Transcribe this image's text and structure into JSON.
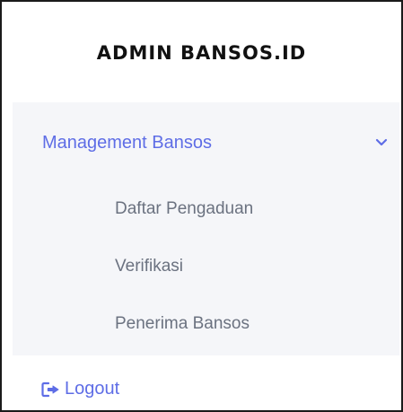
{
  "brand": {
    "title": "ADMIN BANSOS.ID"
  },
  "menu": {
    "label": "Management Bansos",
    "expanded": true,
    "chevron_icon": "chevron-down-icon",
    "submenu": [
      {
        "label": "Daftar Pengaduan"
      },
      {
        "label": "Verifikasi"
      },
      {
        "label": "Penerima Bansos"
      }
    ]
  },
  "logout": {
    "label": "Logout",
    "icon": "sign-out-icon"
  },
  "colors": {
    "accent": "#5e6de6",
    "panel_bg": "#f5f6f9",
    "submenu_text": "#6b7280",
    "brand_text": "#111111"
  }
}
